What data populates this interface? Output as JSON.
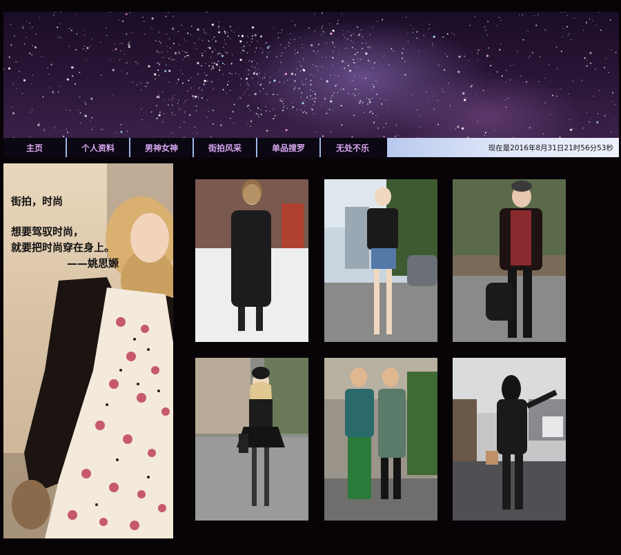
{
  "nav": {
    "items": [
      {
        "label": "主页"
      },
      {
        "label": "个人资料"
      },
      {
        "label": "男神女神"
      },
      {
        "label": "街拍风采"
      },
      {
        "label": "单品搜罗"
      },
      {
        "label": "无处不乐"
      }
    ]
  },
  "clock": {
    "text": "现在是2016年8月31日21时56分53秒"
  },
  "hero": {
    "line1": "街拍，时尚",
    "line2": "想要驾驭时尚，",
    "line3": "就要把时尚穿在身上。",
    "line4": "——姚思嫄"
  },
  "photos": [
    {
      "name": "street-photo-snow-coat"
    },
    {
      "name": "street-photo-leather-jacket"
    },
    {
      "name": "street-photo-burgundy-sweater"
    },
    {
      "name": "street-photo-black-dress-beanie"
    },
    {
      "name": "street-photo-couple-green"
    },
    {
      "name": "street-photo-black-hood"
    }
  ]
}
